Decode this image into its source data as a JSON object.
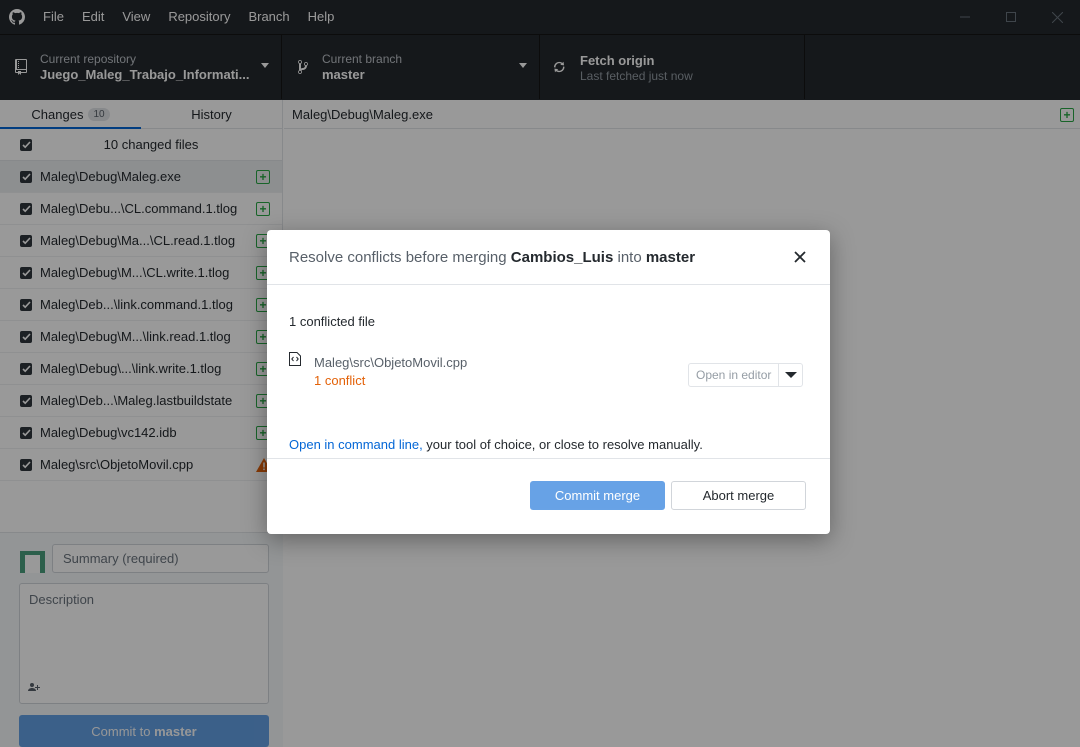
{
  "menu": {
    "items": [
      "File",
      "Edit",
      "View",
      "Repository",
      "Branch",
      "Help"
    ]
  },
  "toolbar": {
    "repo_label": "Current repository",
    "repo_value": "Juego_Maleg_Trabajo_Informati...",
    "branch_label": "Current branch",
    "branch_value": "master",
    "fetch_title": "Fetch origin",
    "fetch_sub": "Last fetched just now"
  },
  "tabs": {
    "changes_label": "Changes",
    "changes_count": "10",
    "history_label": "History"
  },
  "files_header": "10 changed files",
  "files": [
    {
      "path": "Maleg\\Debug\\Maleg.exe",
      "status": "added"
    },
    {
      "path": "Maleg\\Debu...\\CL.command.1.tlog",
      "status": "added"
    },
    {
      "path": "Maleg\\Debug\\Ma...\\CL.read.1.tlog",
      "status": "added"
    },
    {
      "path": "Maleg\\Debug\\M...\\CL.write.1.tlog",
      "status": "added"
    },
    {
      "path": "Maleg\\Deb...\\link.command.1.tlog",
      "status": "added"
    },
    {
      "path": "Maleg\\Debug\\M...\\link.read.1.tlog",
      "status": "added"
    },
    {
      "path": "Maleg\\Debug\\...\\link.write.1.tlog",
      "status": "added"
    },
    {
      "path": "Maleg\\Deb...\\Maleg.lastbuildstate",
      "status": "added"
    },
    {
      "path": "Maleg\\Debug\\vc142.idb",
      "status": "added"
    },
    {
      "path": "Maleg\\src\\ObjetoMovil.cpp",
      "status": "conflict"
    }
  ],
  "commit": {
    "summary_placeholder": "Summary (required)",
    "description_placeholder": "Description",
    "button_prefix": "Commit to ",
    "button_branch": "master"
  },
  "main": {
    "path": "Maleg\\Debug\\Maleg.exe"
  },
  "dialog": {
    "title_prefix": "Resolve conflicts before merging ",
    "source_branch": "Cambios_Luis",
    "title_mid": " into ",
    "target_branch": "master",
    "conflicts_title": "1 conflicted file",
    "file_path": "Maleg\\src\\ObjetoMovil.cpp",
    "conflict_count": "1 conflict",
    "open_editor_label": "Open in editor",
    "hint_link": "Open in command line,",
    "hint_rest": " your tool of choice, or close to resolve manually.",
    "commit_merge_label": "Commit merge",
    "abort_merge_label": "Abort merge"
  },
  "colors": {
    "accent": "#0366d6",
    "added": "#28a745",
    "conflict": "#e36209",
    "chrome": "#24292e"
  }
}
